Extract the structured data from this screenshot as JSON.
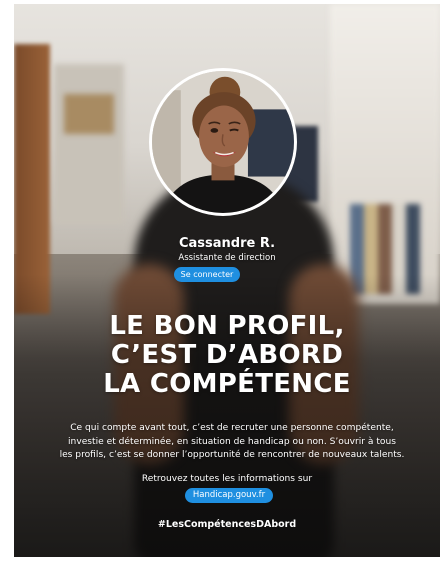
{
  "profile": {
    "name": "Cassandre R.",
    "role": "Assistante de direction",
    "connect_label": "Se connecter"
  },
  "headline": {
    "lines": [
      "LE BON PROFIL,",
      "C’EST D’ABORD",
      "LA COMPÉTENCE"
    ]
  },
  "body": {
    "lines": [
      "Ce qui compte avant tout, c’est de recruter une personne compétente,",
      "investie et déterminée, en situation de handicap ou non. S’ouvrir à tous",
      "les profils, c’est se donner l’opportunité de rencontrer de nouveaux talents."
    ]
  },
  "info": {
    "text": "Retrouvez toutes les informations sur",
    "link_label": "Handicap.gouv.fr"
  },
  "hashtag": "#LesCompétencesDAbord",
  "colors": {
    "accent": "#1f8fe0",
    "text": "#ffffff"
  }
}
